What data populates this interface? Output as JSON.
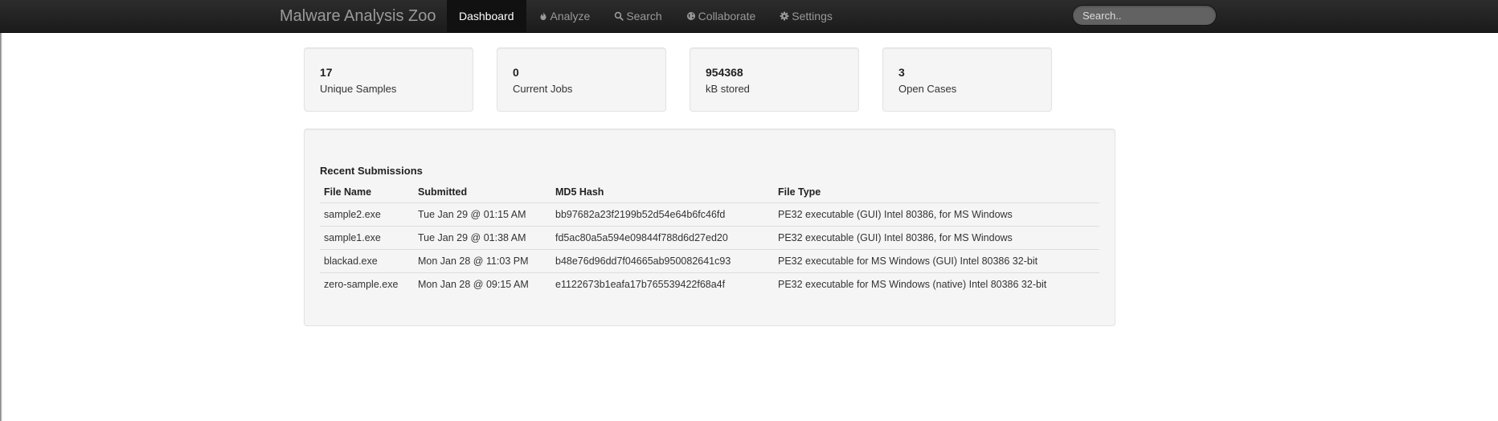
{
  "app": {
    "brand": "Malware Analysis Zoo"
  },
  "nav": {
    "items": [
      {
        "label": "Dashboard",
        "icon": "",
        "active": true
      },
      {
        "label": "Analyze",
        "icon": "fire-icon",
        "active": false
      },
      {
        "label": "Search",
        "icon": "search-icon",
        "active": false
      },
      {
        "label": "Collaborate",
        "icon": "globe-icon",
        "active": false
      },
      {
        "label": "Settings",
        "icon": "gear-icon",
        "active": false
      }
    ]
  },
  "search": {
    "placeholder": "Search.."
  },
  "stats": [
    {
      "value": "17",
      "label": "Unique Samples"
    },
    {
      "value": "0",
      "label": "Current Jobs"
    },
    {
      "value": "954368",
      "label": "kB stored"
    },
    {
      "value": "3",
      "label": "Open Cases"
    }
  ],
  "recent": {
    "title": "Recent Submissions",
    "columns": [
      "File Name",
      "Submitted",
      "MD5 Hash",
      "File Type"
    ],
    "rows": [
      [
        "sample2.exe",
        "Tue Jan 29 @ 01:15 AM",
        "bb97682a23f2199b52d54e64b6fc46fd",
        "PE32 executable (GUI) Intel 80386, for MS Windows"
      ],
      [
        "sample1.exe",
        "Tue Jan 29 @ 01:38 AM",
        "fd5ac80a5a594e09844f788d6d27ed20",
        "PE32 executable (GUI) Intel 80386, for MS Windows"
      ],
      [
        "blackad.exe",
        "Mon Jan 28 @ 11:03 PM",
        "b48e76d96dd7f04665ab950082641c93",
        "PE32 executable for MS Windows (GUI) Intel 80386 32-bit"
      ],
      [
        "zero-sample.exe",
        "Mon Jan 28 @ 09:15 AM",
        "e1122673b1eafa17b765539422f68a4f",
        "PE32 executable for MS Windows (native) Intel 80386 32-bit"
      ]
    ]
  },
  "colors": {
    "navbar": "#1b1b1b",
    "active_tab": "#111111",
    "well": "#f5f5f5"
  }
}
